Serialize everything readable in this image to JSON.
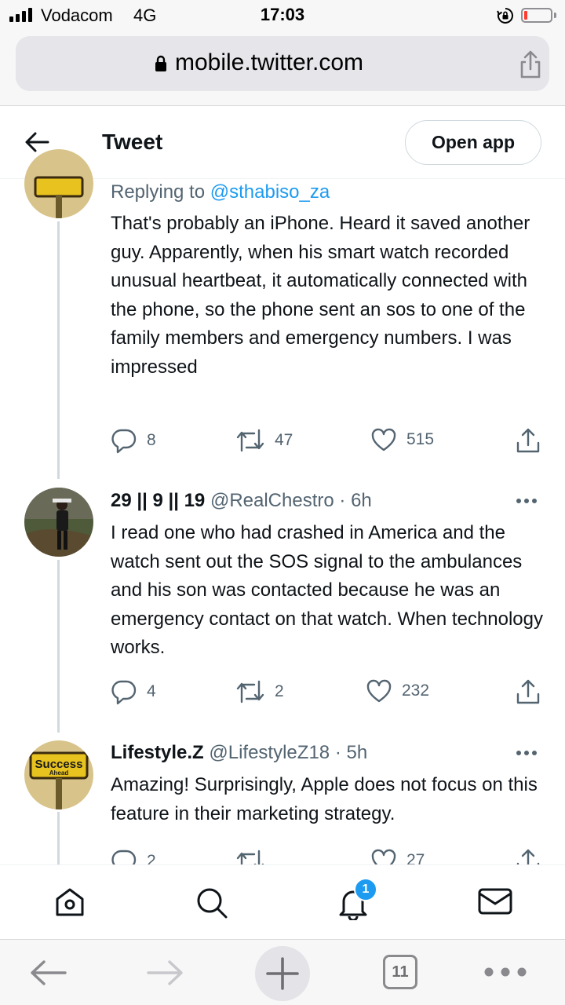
{
  "status_bar": {
    "carrier": "Vodacom",
    "network": "4G",
    "time": "17:03",
    "icons": [
      "signal-bars-icon",
      "orientation-lock-icon",
      "battery-icon"
    ]
  },
  "browser": {
    "url": "mobile.twitter.com",
    "tab_count": "11"
  },
  "header": {
    "title": "Tweet",
    "open_app_label": "Open app"
  },
  "tweets": [
    {
      "replying_label": "Replying to",
      "replying_handle": "@sthabiso_za",
      "text": "That's probably an iPhone. Heard it saved another guy. Apparently, when his smart watch recorded unusual heartbeat, it automatically connected with the phone, so the phone sent an sos to one of the family members and emergency numbers. I was impressed",
      "replies": "8",
      "retweets": "47",
      "likes": "515"
    },
    {
      "name": "29 || 9 || 19",
      "handle": "@RealChestro",
      "sep": "·",
      "time": "6h",
      "text": "I read one who had crashed in America and the watch sent out the SOS signal to the ambulances and his son was contacted because he was an emergency contact on that watch. When technology works.",
      "replies": "4",
      "retweets": "2",
      "likes": "232"
    },
    {
      "name": "Lifestyle.Z",
      "handle": "@LifestyleZ18",
      "sep": "·",
      "time": "5h",
      "avatar_sign_top": "Success",
      "avatar_sign_bottom": "Ahead",
      "text": "Amazing! Surprisingly, Apple does not focus on this feature in their marketing strategy.",
      "replies": "2",
      "retweets": "",
      "likes": "27"
    }
  ],
  "bottom_nav": {
    "notification_badge": "1",
    "items": [
      "home-icon",
      "search-icon",
      "bell-icon",
      "mail-icon"
    ]
  },
  "colors": {
    "accent": "#1d9bf0",
    "text": "#0f1419",
    "muted": "#536471",
    "border": "#cfd9de"
  }
}
